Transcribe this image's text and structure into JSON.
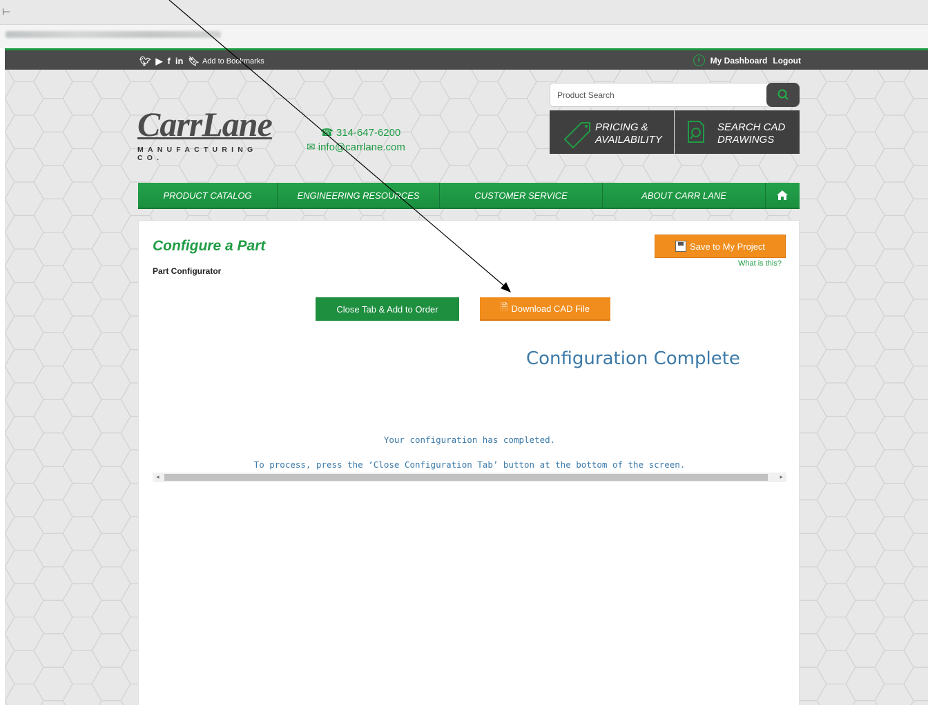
{
  "topbar": {
    "social_icons": [
      "twitter-icon",
      "youtube-icon",
      "facebook-icon",
      "linkedin-icon",
      "bookmark-icon"
    ],
    "bookmarks_label": "Add to Bookmarks",
    "dashboard_label": "My Dashboard",
    "logout_label": "Logout"
  },
  "header": {
    "logo_text": "CarrLane",
    "logo_sub": "MANUFACTURING CO.",
    "phone": "314-647-6200",
    "email": "info@carrlane.com",
    "search_placeholder": "Product Search",
    "tile_pricing": "PRICING & AVAILABILITY",
    "tile_cad": "SEARCH CAD DRAWINGS",
    "tile_pricing_l1": "PRICING &",
    "tile_pricing_l2": "AVAILABILITY",
    "tile_cad_l1": "SEARCH CAD",
    "tile_cad_l2": "DRAWINGS"
  },
  "nav": {
    "items": [
      "PRODUCT CATALOG",
      "ENGINEERING RESOURCES",
      "CUSTOMER SERVICE",
      "ABOUT CARR LANE"
    ]
  },
  "content": {
    "title": "Configure a Part",
    "subtitle": "Part Configurator",
    "save_button": "Save to My Project",
    "what_is_this": "What is this?",
    "close_button": "Close Tab & Add to Order",
    "download_button": "Download CAD File",
    "config_title": "Configuration Complete",
    "config_line1": "Your configuration has completed.",
    "config_line2": "To process, press the ‘Close Configuration Tab’ button at the bottom of the screen."
  },
  "colors": {
    "brand_green": "#1f9c44",
    "accent_orange": "#f08d1d",
    "dark_bar": "#4a4a4a",
    "config_blue": "#3c7aa9"
  }
}
